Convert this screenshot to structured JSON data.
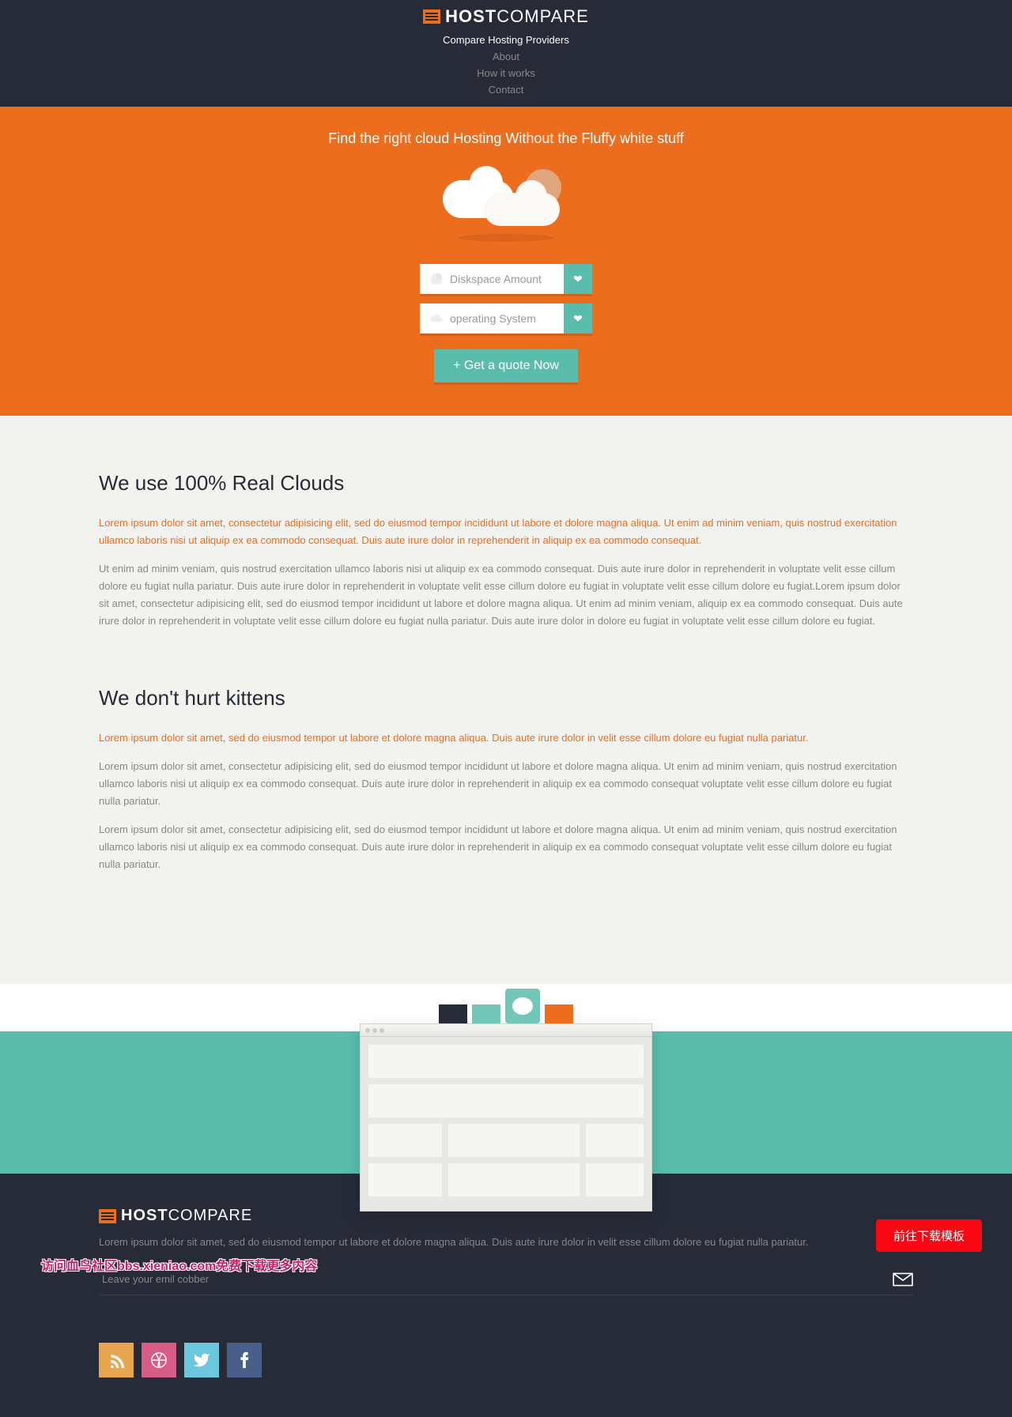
{
  "header": {
    "logo_bold": "HOST",
    "logo_light": "COMPARE",
    "nav": [
      {
        "label": "Compare Hosting Providers",
        "active": true
      },
      {
        "label": "About",
        "active": false
      },
      {
        "label": "How it works",
        "active": false
      },
      {
        "label": "Contact",
        "active": false
      }
    ]
  },
  "hero": {
    "title": "Find the right cloud Hosting Without the Fluffy white stuff",
    "selector1_label": "Diskspace Amount",
    "selector2_label": "operating System",
    "quote_button": "+ Get a quote Now"
  },
  "sections": [
    {
      "heading": "We use 100% Real Clouds",
      "intro": "Lorem ipsum dolor sit amet, consectetur adipisicing elit, sed do eiusmod tempor incididunt ut labore et dolore magna aliqua. Ut enim ad minim veniam, quis nostrud exercitation ullamco laboris nisi ut aliquip ex ea commodo consequat. Duis aute irure dolor in reprehenderit in aliquip ex ea commodo consequat.",
      "paragraphs": [
        "Ut enim ad minim veniam, quis nostrud exercitation ullamco laboris nisi ut aliquip ex ea commodo consequat. Duis aute irure dolor in reprehenderit in voluptate velit esse cillum dolore eu fugiat nulla pariatur. Duis aute irure dolor in reprehenderit in voluptate velit esse cillum dolore eu fugiat in voluptate velit esse cillum dolore eu fugiat.Lorem ipsum dolor sit amet, consectetur adipisicing elit, sed do eiusmod tempor incididunt ut labore et dolore magna aliqua. Ut enim ad minim veniam, aliquip ex ea commodo consequat. Duis aute irure dolor in reprehenderit in voluptate velit esse cillum dolore eu fugiat nulla pariatur. Duis aute irure dolor in dolore eu fugiat in voluptate velit esse cillum dolore eu fugiat."
      ]
    },
    {
      "heading": "We don't hurt kittens",
      "intro": "Lorem ipsum dolor sit amet, sed do eiusmod tempor ut labore et dolore magna aliqua. Duis aute irure dolor in velit esse cillum dolore eu fugiat nulla pariatur.",
      "paragraphs": [
        "Lorem ipsum dolor sit amet, consectetur adipisicing elit, sed do eiusmod tempor incididunt ut labore et dolore magna aliqua. Ut enim ad minim veniam, quis nostrud exercitation ullamco laboris nisi ut aliquip ex ea commodo consequat. Duis aute irure dolor in reprehenderit in aliquip ex ea commodo consequat voluptate velit esse cillum dolore eu fugiat nulla pariatur.",
        "Lorem ipsum dolor sit amet, consectetur adipisicing elit, sed do eiusmod tempor incididunt ut labore et dolore magna aliqua. Ut enim ad minim veniam, quis nostrud exercitation ullamco laboris nisi ut aliquip ex ea commodo consequat. Duis aute irure dolor in reprehenderit in aliquip ex ea commodo consequat voluptate velit esse cillum dolore eu fugiat nulla pariatur."
      ]
    }
  ],
  "footer": {
    "logo_bold": "HOST",
    "logo_light": "COMPARE",
    "text": "Lorem ipsum dolor sit amet, sed do eiusmod tempor ut labore et dolore magna aliqua. Duis aute irure dolor in velit esse cillum dolore eu fugiat nulla pariatur.",
    "email_placeholder": "Leave your emil cobber"
  },
  "overlay": {
    "visit_text": "访问血鸟社区bbs.xieniao.com免费下载更多内容",
    "download_button": "前往下载模板"
  }
}
